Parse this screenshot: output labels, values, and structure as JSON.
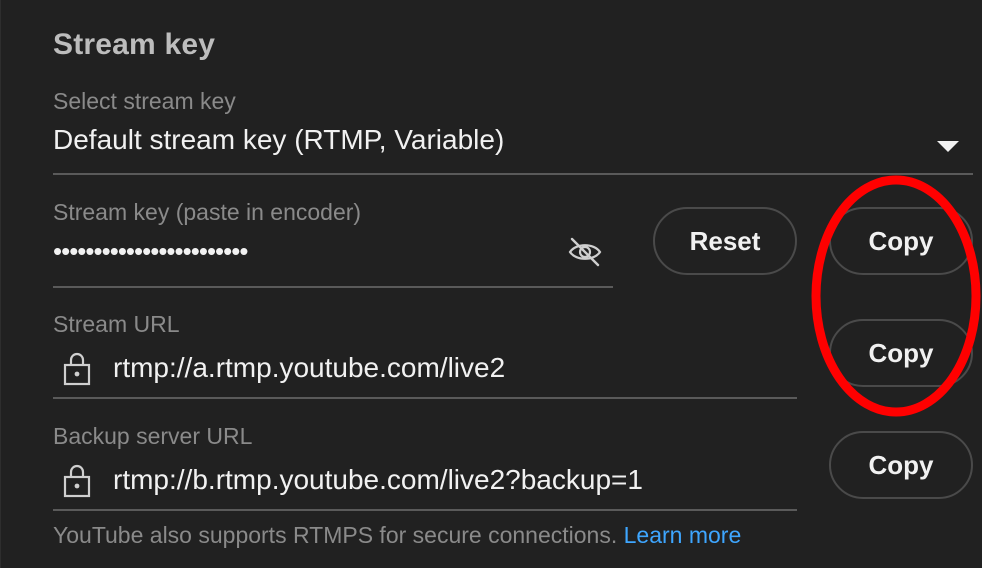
{
  "section": {
    "title": "Stream key"
  },
  "select_key": {
    "label": "Select stream key",
    "value": "Default stream key (RTMP, Variable)",
    "icon": "dropdown-arrow-icon"
  },
  "stream_key": {
    "label": "Stream key (paste in encoder)",
    "masked_value": "••••••••••••••••••••••••",
    "visibility_icon": "eye-off-icon",
    "reset_label": "Reset",
    "copy_label": "Copy"
  },
  "stream_url": {
    "label": "Stream URL",
    "value": "rtmp://a.rtmp.youtube.com/live2",
    "icon": "lock-icon",
    "copy_label": "Copy"
  },
  "backup_url": {
    "label": "Backup server URL",
    "value": "rtmp://b.rtmp.youtube.com/live2?backup=1",
    "icon": "lock-icon",
    "copy_label": "Copy"
  },
  "footer": {
    "text": "YouTube also supports RTMPS for secure connections.",
    "link": "Learn more"
  },
  "colors": {
    "background": "#212121",
    "text": "#f1f1f1",
    "muted": "#8a8a8a",
    "link": "#3ea6ff",
    "annotation": "#ff0000"
  }
}
